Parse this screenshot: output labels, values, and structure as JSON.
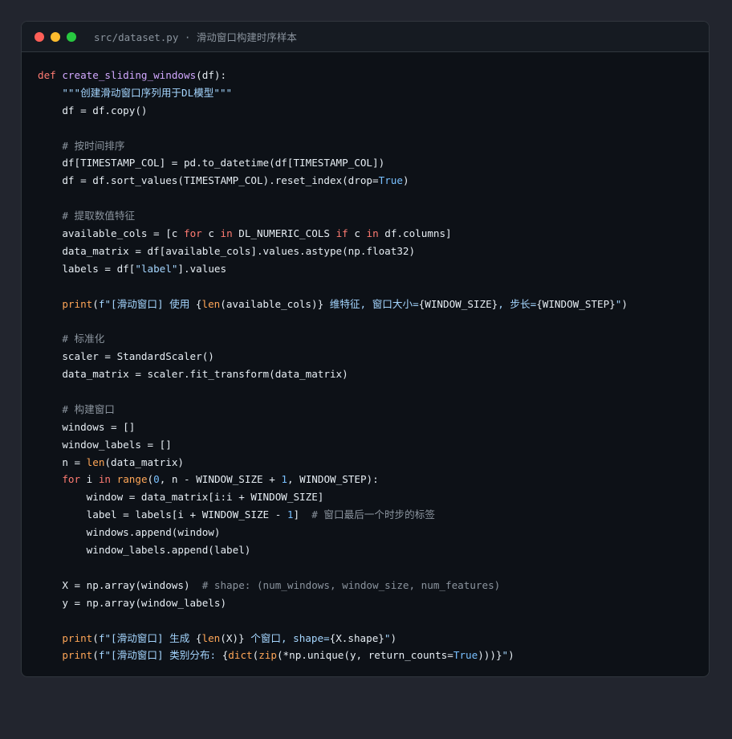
{
  "window": {
    "title": "src/dataset.py · 滑动窗口构建时序样本",
    "controls": {
      "close_color": "#ff5f57",
      "minimize_color": "#febc2e",
      "maximize_color": "#28c840"
    }
  },
  "code": {
    "lines": [
      [
        {
          "t": "kw",
          "v": "def"
        },
        {
          "t": "",
          "v": " "
        },
        {
          "t": "fn",
          "v": "create_sliding_windows"
        },
        {
          "t": "",
          "v": "(df):"
        }
      ],
      [
        {
          "t": "",
          "v": "    "
        },
        {
          "t": "str",
          "v": "\"\"\"创建滑动窗口序列用于DL模型\"\"\""
        }
      ],
      [
        {
          "t": "",
          "v": "    df = df.copy()"
        }
      ],
      [],
      [
        {
          "t": "",
          "v": "    "
        },
        {
          "t": "cmt",
          "v": "# 按时间排序"
        }
      ],
      [
        {
          "t": "",
          "v": "    df[TIMESTAMP_COL] = pd.to_datetime(df[TIMESTAMP_COL])"
        }
      ],
      [
        {
          "t": "",
          "v": "    df = df.sort_values(TIMESTAMP_COL).reset_index(drop="
        },
        {
          "t": "num",
          "v": "True"
        },
        {
          "t": "",
          "v": ")"
        }
      ],
      [],
      [
        {
          "t": "",
          "v": "    "
        },
        {
          "t": "cmt",
          "v": "# 提取数值特征"
        }
      ],
      [
        {
          "t": "",
          "v": "    available_cols = [c "
        },
        {
          "t": "kw",
          "v": "for"
        },
        {
          "t": "",
          "v": " c "
        },
        {
          "t": "kw",
          "v": "in"
        },
        {
          "t": "",
          "v": " DL_NUMERIC_COLS "
        },
        {
          "t": "kw",
          "v": "if"
        },
        {
          "t": "",
          "v": " c "
        },
        {
          "t": "kw",
          "v": "in"
        },
        {
          "t": "",
          "v": " df.columns]"
        }
      ],
      [
        {
          "t": "",
          "v": "    data_matrix = df[available_cols].values.astype(np.float32)"
        }
      ],
      [
        {
          "t": "",
          "v": "    labels = df["
        },
        {
          "t": "str",
          "v": "\"label\""
        },
        {
          "t": "",
          "v": "].values"
        }
      ],
      [],
      [
        {
          "t": "",
          "v": "    "
        },
        {
          "t": "bi",
          "v": "print"
        },
        {
          "t": "",
          "v": "("
        },
        {
          "t": "str",
          "v": "f\"[滑动窗口] 使用 "
        },
        {
          "t": "",
          "v": "{"
        },
        {
          "t": "bi",
          "v": "len"
        },
        {
          "t": "",
          "v": "(available_cols)}"
        },
        {
          "t": "str",
          "v": " 维特征, 窗口大小="
        },
        {
          "t": "",
          "v": "{WINDOW_SIZE}"
        },
        {
          "t": "str",
          "v": ", 步长="
        },
        {
          "t": "",
          "v": "{WINDOW_STEP}"
        },
        {
          "t": "str",
          "v": "\""
        },
        {
          "t": "",
          "v": ")"
        }
      ],
      [],
      [
        {
          "t": "",
          "v": "    "
        },
        {
          "t": "cmt",
          "v": "# 标准化"
        }
      ],
      [
        {
          "t": "",
          "v": "    scaler = StandardScaler()"
        }
      ],
      [
        {
          "t": "",
          "v": "    data_matrix = scaler.fit_transform(data_matrix)"
        }
      ],
      [],
      [
        {
          "t": "",
          "v": "    "
        },
        {
          "t": "cmt",
          "v": "# 构建窗口"
        }
      ],
      [
        {
          "t": "",
          "v": "    windows = []"
        }
      ],
      [
        {
          "t": "",
          "v": "    window_labels = []"
        }
      ],
      [
        {
          "t": "",
          "v": "    n = "
        },
        {
          "t": "bi",
          "v": "len"
        },
        {
          "t": "",
          "v": "(data_matrix)"
        }
      ],
      [
        {
          "t": "",
          "v": "    "
        },
        {
          "t": "kw",
          "v": "for"
        },
        {
          "t": "",
          "v": " i "
        },
        {
          "t": "kw",
          "v": "in"
        },
        {
          "t": "",
          "v": " "
        },
        {
          "t": "bi",
          "v": "range"
        },
        {
          "t": "",
          "v": "("
        },
        {
          "t": "num",
          "v": "0"
        },
        {
          "t": "",
          "v": ", n - WINDOW_SIZE + "
        },
        {
          "t": "num",
          "v": "1"
        },
        {
          "t": "",
          "v": ", WINDOW_STEP):"
        }
      ],
      [
        {
          "t": "",
          "v": "        window = data_matrix[i:i + WINDOW_SIZE]"
        }
      ],
      [
        {
          "t": "",
          "v": "        label = labels[i + WINDOW_SIZE - "
        },
        {
          "t": "num",
          "v": "1"
        },
        {
          "t": "",
          "v": "]  "
        },
        {
          "t": "cmt",
          "v": "# 窗口最后一个时步的标签"
        }
      ],
      [
        {
          "t": "",
          "v": "        windows.append(window)"
        }
      ],
      [
        {
          "t": "",
          "v": "        window_labels.append(label)"
        }
      ],
      [],
      [
        {
          "t": "",
          "v": "    X = np.array(windows)  "
        },
        {
          "t": "cmt",
          "v": "# shape: (num_windows, window_size, num_features)"
        }
      ],
      [
        {
          "t": "",
          "v": "    y = np.array(window_labels)"
        }
      ],
      [],
      [
        {
          "t": "",
          "v": "    "
        },
        {
          "t": "bi",
          "v": "print"
        },
        {
          "t": "",
          "v": "("
        },
        {
          "t": "str",
          "v": "f\"[滑动窗口] 生成 "
        },
        {
          "t": "",
          "v": "{"
        },
        {
          "t": "bi",
          "v": "len"
        },
        {
          "t": "",
          "v": "(X)}"
        },
        {
          "t": "str",
          "v": " 个窗口, shape="
        },
        {
          "t": "",
          "v": "{X.shape}"
        },
        {
          "t": "str",
          "v": "\""
        },
        {
          "t": "",
          "v": ")"
        }
      ],
      [
        {
          "t": "",
          "v": "    "
        },
        {
          "t": "bi",
          "v": "print"
        },
        {
          "t": "",
          "v": "("
        },
        {
          "t": "str",
          "v": "f\"[滑动窗口] 类别分布: "
        },
        {
          "t": "",
          "v": "{"
        },
        {
          "t": "bi",
          "v": "dict"
        },
        {
          "t": "",
          "v": "("
        },
        {
          "t": "bi",
          "v": "zip"
        },
        {
          "t": "",
          "v": "(*np.unique(y, return_counts="
        },
        {
          "t": "num",
          "v": "True"
        },
        {
          "t": "",
          "v": ")))}"
        },
        {
          "t": "str",
          "v": "\""
        },
        {
          "t": "",
          "v": ")"
        }
      ]
    ]
  }
}
